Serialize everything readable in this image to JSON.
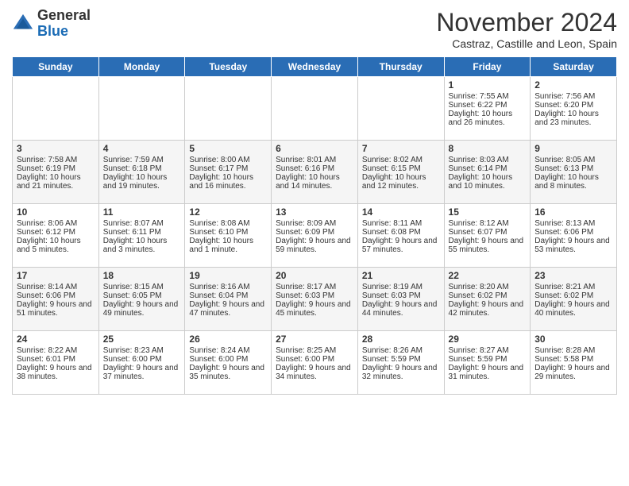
{
  "logo": {
    "general": "General",
    "blue": "Blue"
  },
  "title": "November 2024",
  "location": "Castraz, Castille and Leon, Spain",
  "days_header": [
    "Sunday",
    "Monday",
    "Tuesday",
    "Wednesday",
    "Thursday",
    "Friday",
    "Saturday"
  ],
  "weeks": [
    [
      {
        "day": "",
        "info": ""
      },
      {
        "day": "",
        "info": ""
      },
      {
        "day": "",
        "info": ""
      },
      {
        "day": "",
        "info": ""
      },
      {
        "day": "",
        "info": ""
      },
      {
        "day": "1",
        "info": "Sunrise: 7:55 AM\nSunset: 6:22 PM\nDaylight: 10 hours and 26 minutes."
      },
      {
        "day": "2",
        "info": "Sunrise: 7:56 AM\nSunset: 6:20 PM\nDaylight: 10 hours and 23 minutes."
      }
    ],
    [
      {
        "day": "3",
        "info": "Sunrise: 7:58 AM\nSunset: 6:19 PM\nDaylight: 10 hours and 21 minutes."
      },
      {
        "day": "4",
        "info": "Sunrise: 7:59 AM\nSunset: 6:18 PM\nDaylight: 10 hours and 19 minutes."
      },
      {
        "day": "5",
        "info": "Sunrise: 8:00 AM\nSunset: 6:17 PM\nDaylight: 10 hours and 16 minutes."
      },
      {
        "day": "6",
        "info": "Sunrise: 8:01 AM\nSunset: 6:16 PM\nDaylight: 10 hours and 14 minutes."
      },
      {
        "day": "7",
        "info": "Sunrise: 8:02 AM\nSunset: 6:15 PM\nDaylight: 10 hours and 12 minutes."
      },
      {
        "day": "8",
        "info": "Sunrise: 8:03 AM\nSunset: 6:14 PM\nDaylight: 10 hours and 10 minutes."
      },
      {
        "day": "9",
        "info": "Sunrise: 8:05 AM\nSunset: 6:13 PM\nDaylight: 10 hours and 8 minutes."
      }
    ],
    [
      {
        "day": "10",
        "info": "Sunrise: 8:06 AM\nSunset: 6:12 PM\nDaylight: 10 hours and 5 minutes."
      },
      {
        "day": "11",
        "info": "Sunrise: 8:07 AM\nSunset: 6:11 PM\nDaylight: 10 hours and 3 minutes."
      },
      {
        "day": "12",
        "info": "Sunrise: 8:08 AM\nSunset: 6:10 PM\nDaylight: 10 hours and 1 minute."
      },
      {
        "day": "13",
        "info": "Sunrise: 8:09 AM\nSunset: 6:09 PM\nDaylight: 9 hours and 59 minutes."
      },
      {
        "day": "14",
        "info": "Sunrise: 8:11 AM\nSunset: 6:08 PM\nDaylight: 9 hours and 57 minutes."
      },
      {
        "day": "15",
        "info": "Sunrise: 8:12 AM\nSunset: 6:07 PM\nDaylight: 9 hours and 55 minutes."
      },
      {
        "day": "16",
        "info": "Sunrise: 8:13 AM\nSunset: 6:06 PM\nDaylight: 9 hours and 53 minutes."
      }
    ],
    [
      {
        "day": "17",
        "info": "Sunrise: 8:14 AM\nSunset: 6:06 PM\nDaylight: 9 hours and 51 minutes."
      },
      {
        "day": "18",
        "info": "Sunrise: 8:15 AM\nSunset: 6:05 PM\nDaylight: 9 hours and 49 minutes."
      },
      {
        "day": "19",
        "info": "Sunrise: 8:16 AM\nSunset: 6:04 PM\nDaylight: 9 hours and 47 minutes."
      },
      {
        "day": "20",
        "info": "Sunrise: 8:17 AM\nSunset: 6:03 PM\nDaylight: 9 hours and 45 minutes."
      },
      {
        "day": "21",
        "info": "Sunrise: 8:19 AM\nSunset: 6:03 PM\nDaylight: 9 hours and 44 minutes."
      },
      {
        "day": "22",
        "info": "Sunrise: 8:20 AM\nSunset: 6:02 PM\nDaylight: 9 hours and 42 minutes."
      },
      {
        "day": "23",
        "info": "Sunrise: 8:21 AM\nSunset: 6:02 PM\nDaylight: 9 hours and 40 minutes."
      }
    ],
    [
      {
        "day": "24",
        "info": "Sunrise: 8:22 AM\nSunset: 6:01 PM\nDaylight: 9 hours and 38 minutes."
      },
      {
        "day": "25",
        "info": "Sunrise: 8:23 AM\nSunset: 6:00 PM\nDaylight: 9 hours and 37 minutes."
      },
      {
        "day": "26",
        "info": "Sunrise: 8:24 AM\nSunset: 6:00 PM\nDaylight: 9 hours and 35 minutes."
      },
      {
        "day": "27",
        "info": "Sunrise: 8:25 AM\nSunset: 6:00 PM\nDaylight: 9 hours and 34 minutes."
      },
      {
        "day": "28",
        "info": "Sunrise: 8:26 AM\nSunset: 5:59 PM\nDaylight: 9 hours and 32 minutes."
      },
      {
        "day": "29",
        "info": "Sunrise: 8:27 AM\nSunset: 5:59 PM\nDaylight: 9 hours and 31 minutes."
      },
      {
        "day": "30",
        "info": "Sunrise: 8:28 AM\nSunset: 5:58 PM\nDaylight: 9 hours and 29 minutes."
      }
    ]
  ]
}
